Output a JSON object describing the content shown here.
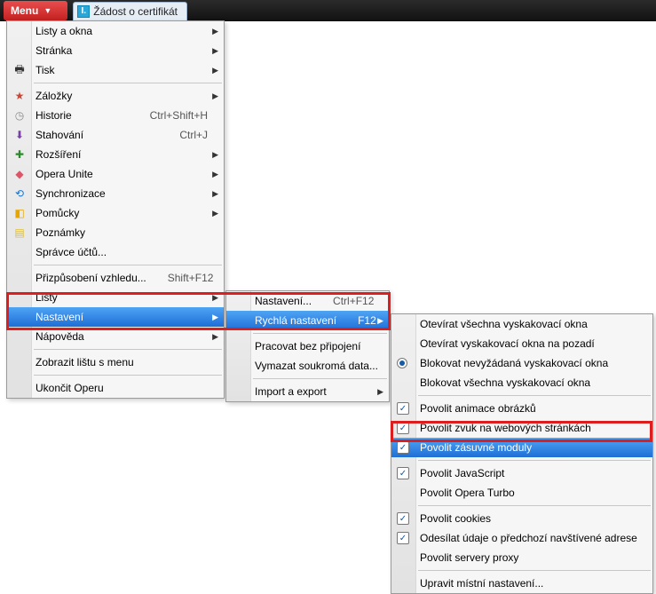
{
  "titlebar": {
    "menu_label": "Menu",
    "tab_label": "Žádost o certifikát",
    "tab_icon_letter": "I."
  },
  "menu1": {
    "items": [
      {
        "label": "Listy a okna",
        "sub": true
      },
      {
        "label": "Stránka",
        "sub": true
      },
      {
        "label": "Tisk",
        "sub": true,
        "icon": "ic-print",
        "glyph": "🖶"
      },
      {
        "sep": true
      },
      {
        "label": "Záložky",
        "sub": true,
        "icon": "ic-star",
        "glyph": "★"
      },
      {
        "label": "Historie",
        "kbd": "Ctrl+Shift+H",
        "icon": "ic-clock",
        "glyph": "◷"
      },
      {
        "label": "Stahování",
        "kbd": "Ctrl+J",
        "icon": "ic-dl",
        "glyph": "⬇"
      },
      {
        "label": "Rozšíření",
        "sub": true,
        "icon": "ic-ext",
        "glyph": "✚"
      },
      {
        "label": "Opera Unite",
        "sub": true,
        "icon": "ic-unite",
        "glyph": "◆"
      },
      {
        "label": "Synchronizace",
        "sub": true,
        "icon": "ic-sync",
        "glyph": "⟲"
      },
      {
        "label": "Pomůcky",
        "sub": true,
        "icon": "ic-widget",
        "glyph": "◧"
      },
      {
        "label": "Poznámky",
        "icon": "ic-note",
        "glyph": "▤"
      },
      {
        "label": "Správce účtů..."
      },
      {
        "sep": true
      },
      {
        "label": "Přizpůsobení vzhledu...",
        "kbd": "Shift+F12"
      },
      {
        "label": "Lišty",
        "sub": true
      },
      {
        "label": "Nastavení",
        "sub": true,
        "selected": true
      },
      {
        "label": "Nápověda",
        "sub": true
      },
      {
        "sep": true
      },
      {
        "label": "Zobrazit lištu s menu"
      },
      {
        "sep": true
      },
      {
        "label": "Ukončit Operu"
      }
    ]
  },
  "menu2": {
    "items": [
      {
        "label": "Nastavení...",
        "kbd": "Ctrl+F12"
      },
      {
        "label": "Rychlá nastavení",
        "kbd": "F12",
        "sub": true,
        "selected": true
      },
      {
        "sep": true
      },
      {
        "label": "Pracovat bez připojení"
      },
      {
        "label": "Vymazat soukromá data..."
      },
      {
        "sep": true
      },
      {
        "label": "Import a export",
        "sub": true
      }
    ]
  },
  "menu3": {
    "items": [
      {
        "label": "Otevírat všechna vyskakovací okna",
        "type": "plain"
      },
      {
        "label": "Otevírat vyskakovací okna na pozadí",
        "type": "plain"
      },
      {
        "label": "Blokovat nevyžádaná vyskakovací okna",
        "type": "radio",
        "checked": true
      },
      {
        "label": "Blokovat všechna vyskakovací okna",
        "type": "plain"
      },
      {
        "sep": true
      },
      {
        "label": "Povolit animace obrázků",
        "type": "check",
        "checked": true
      },
      {
        "label": "Povolit zvuk na webových stránkách",
        "type": "check",
        "checked": true
      },
      {
        "label": "Povolit zásuvné moduly",
        "type": "check",
        "checked": true,
        "selected": true
      },
      {
        "sep": true
      },
      {
        "label": "Povolit JavaScript",
        "type": "check",
        "checked": true
      },
      {
        "label": "Povolit Opera Turbo",
        "type": "plain"
      },
      {
        "sep": true
      },
      {
        "label": "Povolit cookies",
        "type": "check",
        "checked": true
      },
      {
        "label": "Odesílat údaje o předchozí navštívené adrese",
        "type": "check",
        "checked": true
      },
      {
        "label": "Povolit servery proxy",
        "type": "plain"
      },
      {
        "sep": true
      },
      {
        "label": "Upravit místní nastavení...",
        "type": "plain"
      }
    ]
  }
}
